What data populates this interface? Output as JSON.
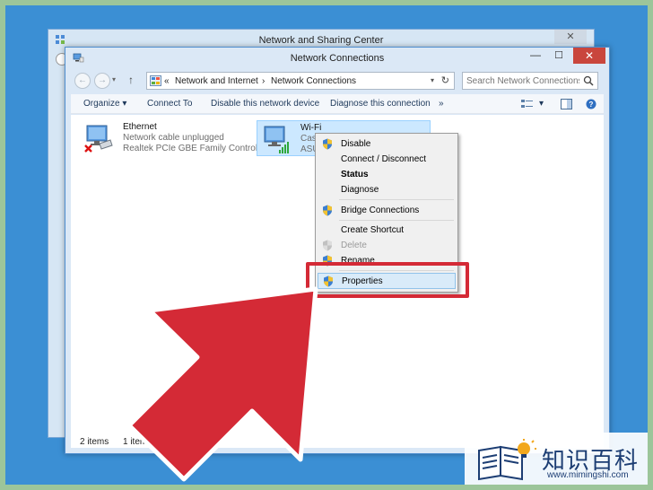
{
  "back_window": {
    "title": "Network and Sharing Center",
    "close_label": "✕"
  },
  "window": {
    "title": "Network Connections",
    "min_label": "—",
    "max_label": "☐",
    "close_label": "✕"
  },
  "address_bar": {
    "back_label": "←",
    "forward_label": "→",
    "dropdown_label": "▾",
    "up_label": "↑",
    "breadcrumb_prefix": "«",
    "breadcrumbs": [
      "Network and Internet",
      "Network Connections"
    ],
    "separator": "›",
    "refresh_label": "↻",
    "search_placeholder": "Search Network Connections"
  },
  "command_bar": {
    "organize": "Organize ▾",
    "connect_to": "Connect To",
    "disable_device": "Disable this network device",
    "diagnose": "Diagnose this connection",
    "more": "»",
    "view_dropdown": "▾"
  },
  "items": [
    {
      "name": "Ethernet",
      "status": "Network cable unplugged",
      "device": "Realtek PCIe GBE Family Controller"
    },
    {
      "name": "Wi-Fi",
      "status": "Castr",
      "device": "ASUS"
    }
  ],
  "context_menu": {
    "items": [
      {
        "label": "Disable",
        "shield": true
      },
      {
        "label": "Connect / Disconnect"
      },
      {
        "label": "Status"
      },
      {
        "label": "Diagnose"
      },
      {
        "label": "Bridge Connections",
        "shield": true
      },
      {
        "label": "Create Shortcut"
      },
      {
        "label": "Delete",
        "shield": true
      },
      {
        "label": "Rename",
        "shield": true
      },
      {
        "label": "Properties",
        "shield": true
      }
    ]
  },
  "status_bar": {
    "count": "2 items",
    "selected": "1 item selected"
  },
  "watermark": {
    "chinese": "知识百科",
    "url": "www.mimingshi.com"
  },
  "colors": {
    "desktop": "#3b8fd4",
    "close_button": "#c9463d",
    "highlight_rect": "#d42a36",
    "arrow": "#d42a36"
  }
}
